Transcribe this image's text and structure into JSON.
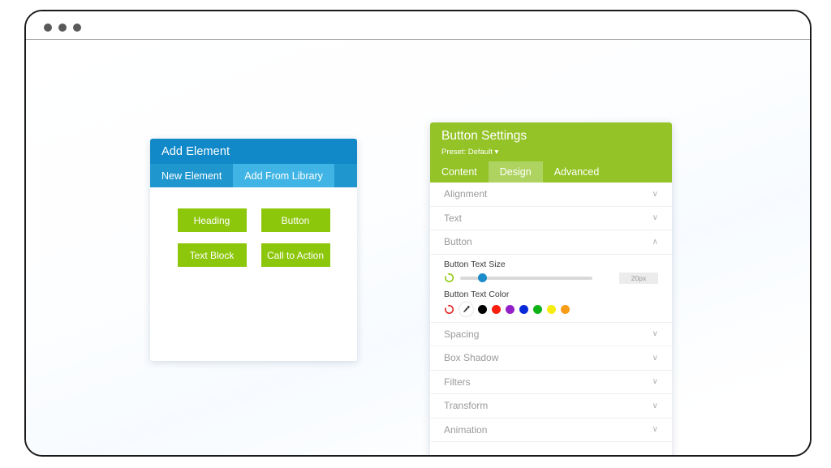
{
  "browser": {
    "dots": [
      "window-dot-1",
      "window-dot-2",
      "window-dot-3"
    ]
  },
  "add_element_panel": {
    "title": "Add Element",
    "tabs": [
      {
        "label": "New Element",
        "active": false
      },
      {
        "label": "Add From Library",
        "active": true
      }
    ],
    "elements": [
      {
        "label": "Heading"
      },
      {
        "label": "Button"
      },
      {
        "label": "Text Block"
      },
      {
        "label": "Call to Action"
      }
    ],
    "colors": {
      "header_bg": "#1189c8",
      "tabbar_bg": "#1f96ce",
      "tab_active_bg": "#3fb4e5",
      "button_bg": "#8dc70c"
    }
  },
  "settings_panel": {
    "title": "Button Settings",
    "preset": "Preset: Default ▾",
    "tabs": [
      {
        "label": "Content",
        "active": false
      },
      {
        "label": "Design",
        "active": true
      },
      {
        "label": "Advanced",
        "active": false
      }
    ],
    "sections": [
      {
        "label": "Alignment",
        "chevron": "∨",
        "expanded": false
      },
      {
        "label": "Text",
        "chevron": "∨",
        "expanded": false
      },
      {
        "label": "Button",
        "chevron": "∧",
        "expanded": true
      }
    ],
    "button_section": {
      "text_size": {
        "label": "Button Text Size",
        "value": "20px",
        "slider_percent": 17,
        "reset_icon": "reset-circle-icon",
        "reset_color": "#8dc70c",
        "handle_color": "#1c8bc9"
      },
      "text_color": {
        "label": "Button Text Color",
        "reset_icon": "reset-circle-icon",
        "reset_color": "#e02020",
        "eyedropper_icon": "eyedropper-icon",
        "swatches": [
          {
            "name": "black",
            "hex": "#000000"
          },
          {
            "name": "red",
            "hex": "#fa1e0e"
          },
          {
            "name": "purple",
            "hex": "#9320c8"
          },
          {
            "name": "blue",
            "hex": "#0a2ad9"
          },
          {
            "name": "green",
            "hex": "#0db216"
          },
          {
            "name": "yellow",
            "hex": "#f7ec12"
          },
          {
            "name": "orange",
            "hex": "#f79c16"
          }
        ]
      }
    },
    "sections_lower": [
      {
        "label": "Spacing",
        "chevron": "∨"
      },
      {
        "label": "Box Shadow",
        "chevron": "∨"
      },
      {
        "label": "Filters",
        "chevron": "∨"
      },
      {
        "label": "Transform",
        "chevron": "∨"
      },
      {
        "label": "Animation",
        "chevron": "∨"
      }
    ],
    "colors": {
      "header_bg": "#94c327",
      "tab_active_bg": "#aed361"
    }
  }
}
